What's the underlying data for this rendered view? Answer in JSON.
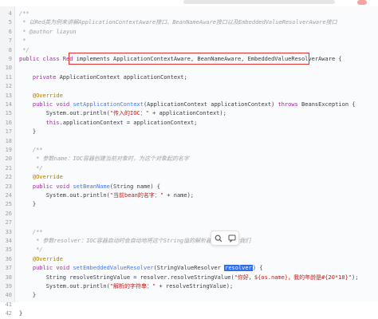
{
  "lines": [
    {
      "n": "4",
      "parts": [
        {
          "t": "/**",
          "c": "cm"
        }
      ]
    },
    {
      "n": "5",
      "parts": [
        {
          "t": " * 以Red类为例来讲解ApplicationContextAware接口、BeanNameAware接口以及EmbeddedValueResolverAware接口",
          "c": "cm"
        }
      ]
    },
    {
      "n": "6",
      "parts": [
        {
          "t": " * @author liayun",
          "c": "cm"
        }
      ]
    },
    {
      "n": "7",
      "parts": [
        {
          "t": " *",
          "c": "cm"
        }
      ]
    },
    {
      "n": "8",
      "parts": [
        {
          "t": " */",
          "c": "cm"
        }
      ]
    },
    {
      "n": "9",
      "parts": [
        {
          "t": "public class Red ",
          "c": "kw"
        },
        {
          "t": "implements ApplicationContextAware, BeanNameAware, EmbeddedValueResolverAware {",
          "c": "ty"
        }
      ]
    },
    {
      "n": "10",
      "parts": [
        {
          "t": "",
          "c": "ty"
        }
      ]
    },
    {
      "n": "11",
      "parts": [
        {
          "t": "    ",
          "c": "ty"
        },
        {
          "t": "private ",
          "c": "kw"
        },
        {
          "t": "ApplicationContext applicationContext;",
          "c": "ty"
        }
      ]
    },
    {
      "n": "12",
      "parts": [
        {
          "t": "",
          "c": "ty"
        }
      ]
    },
    {
      "n": "13",
      "parts": [
        {
          "t": "    @Override",
          "c": "an"
        }
      ]
    },
    {
      "n": "14",
      "parts": [
        {
          "t": "    ",
          "c": "ty"
        },
        {
          "t": "public void ",
          "c": "kw"
        },
        {
          "t": "setApplicationContext",
          "c": "fn"
        },
        {
          "t": "(ApplicationContext applicationContext) ",
          "c": "ty"
        },
        {
          "t": "throws ",
          "c": "kw"
        },
        {
          "t": "BeansException {",
          "c": "ty"
        }
      ]
    },
    {
      "n": "15",
      "parts": [
        {
          "t": "        System.out.println(",
          "c": "ty"
        },
        {
          "t": "\"传入的IOC：\"",
          "c": "st"
        },
        {
          "t": " + applicationContext);",
          "c": "ty"
        }
      ]
    },
    {
      "n": "16",
      "parts": [
        {
          "t": "        ",
          "c": "ty"
        },
        {
          "t": "this",
          "c": "kw"
        },
        {
          "t": ".applicationContext = applicationContext;",
          "c": "ty"
        }
      ]
    },
    {
      "n": "17",
      "parts": [
        {
          "t": "    }",
          "c": "ty"
        }
      ]
    },
    {
      "n": "18",
      "parts": [
        {
          "t": "",
          "c": "ty"
        }
      ]
    },
    {
      "n": "19",
      "parts": [
        {
          "t": "    /**",
          "c": "cm"
        }
      ]
    },
    {
      "n": "20",
      "parts": [
        {
          "t": "     * 参数name：IOC容器创建当前对象时，为这个对象起的名字",
          "c": "cm"
        }
      ]
    },
    {
      "n": "21",
      "parts": [
        {
          "t": "     */",
          "c": "cm"
        }
      ]
    },
    {
      "n": "22",
      "parts": [
        {
          "t": "    @Override",
          "c": "an"
        }
      ]
    },
    {
      "n": "23",
      "parts": [
        {
          "t": "    ",
          "c": "ty"
        },
        {
          "t": "public void ",
          "c": "kw"
        },
        {
          "t": "setBeanName",
          "c": "fn"
        },
        {
          "t": "(String name) {",
          "c": "ty"
        }
      ]
    },
    {
      "n": "24",
      "parts": [
        {
          "t": "        System.out.println(",
          "c": "ty"
        },
        {
          "t": "\"当前bean的名字：\"",
          "c": "st"
        },
        {
          "t": " + name);",
          "c": "ty"
        }
      ]
    },
    {
      "n": "25",
      "parts": [
        {
          "t": "    }",
          "c": "ty"
        }
      ]
    },
    {
      "n": "26",
      "parts": [
        {
          "t": "",
          "c": "ty"
        }
      ]
    },
    {
      "n": "27",
      "parts": [
        {
          "t": "",
          "c": "ty"
        }
      ]
    },
    {
      "n": "33",
      "parts": [
        {
          "t": "    /**",
          "c": "cm"
        }
      ]
    },
    {
      "n": "34",
      "parts": [
        {
          "t": "     * 参数resolver：IOC容器启动时会自动地将这个String值的解析器传递过来给我们",
          "c": "cm"
        }
      ]
    },
    {
      "n": "35",
      "parts": [
        {
          "t": "     */",
          "c": "cm"
        }
      ]
    },
    {
      "n": "36",
      "parts": [
        {
          "t": "    @Override",
          "c": "an"
        }
      ]
    },
    {
      "n": "37",
      "parts": [
        {
          "t": "    ",
          "c": "ty"
        },
        {
          "t": "public void ",
          "c": "kw"
        },
        {
          "t": "setEmbeddedValueResolver",
          "c": "fn"
        },
        {
          "t": "(StringValueResolver ",
          "c": "ty"
        },
        {
          "t": "resolver",
          "c": "sel"
        },
        {
          "t": ") {",
          "c": "ty"
        }
      ]
    },
    {
      "n": "38",
      "parts": [
        {
          "t": "        String resolveStringValue = resolver.resolveStringValue(",
          "c": "ty"
        },
        {
          "t": "\"你好，${os.name}，我的年龄是#{20*18}\"",
          "c": "st"
        },
        {
          "t": ");",
          "c": "ty"
        }
      ]
    },
    {
      "n": "39",
      "parts": [
        {
          "t": "        System.out.println(",
          "c": "ty"
        },
        {
          "t": "\"解析的字符串：\"",
          "c": "st"
        },
        {
          "t": " + resolveStringValue);",
          "c": "ty"
        }
      ]
    },
    {
      "n": "40",
      "parts": [
        {
          "t": "    }",
          "c": "ty"
        }
      ]
    },
    {
      "n": "41",
      "parts": [
        {
          "t": "",
          "c": "ty"
        }
      ]
    },
    {
      "n": "42",
      "parts": [
        {
          "t": "}",
          "c": "ty"
        }
      ]
    }
  ],
  "popover": {
    "icons": [
      "search-icon",
      "comment-icon"
    ]
  }
}
